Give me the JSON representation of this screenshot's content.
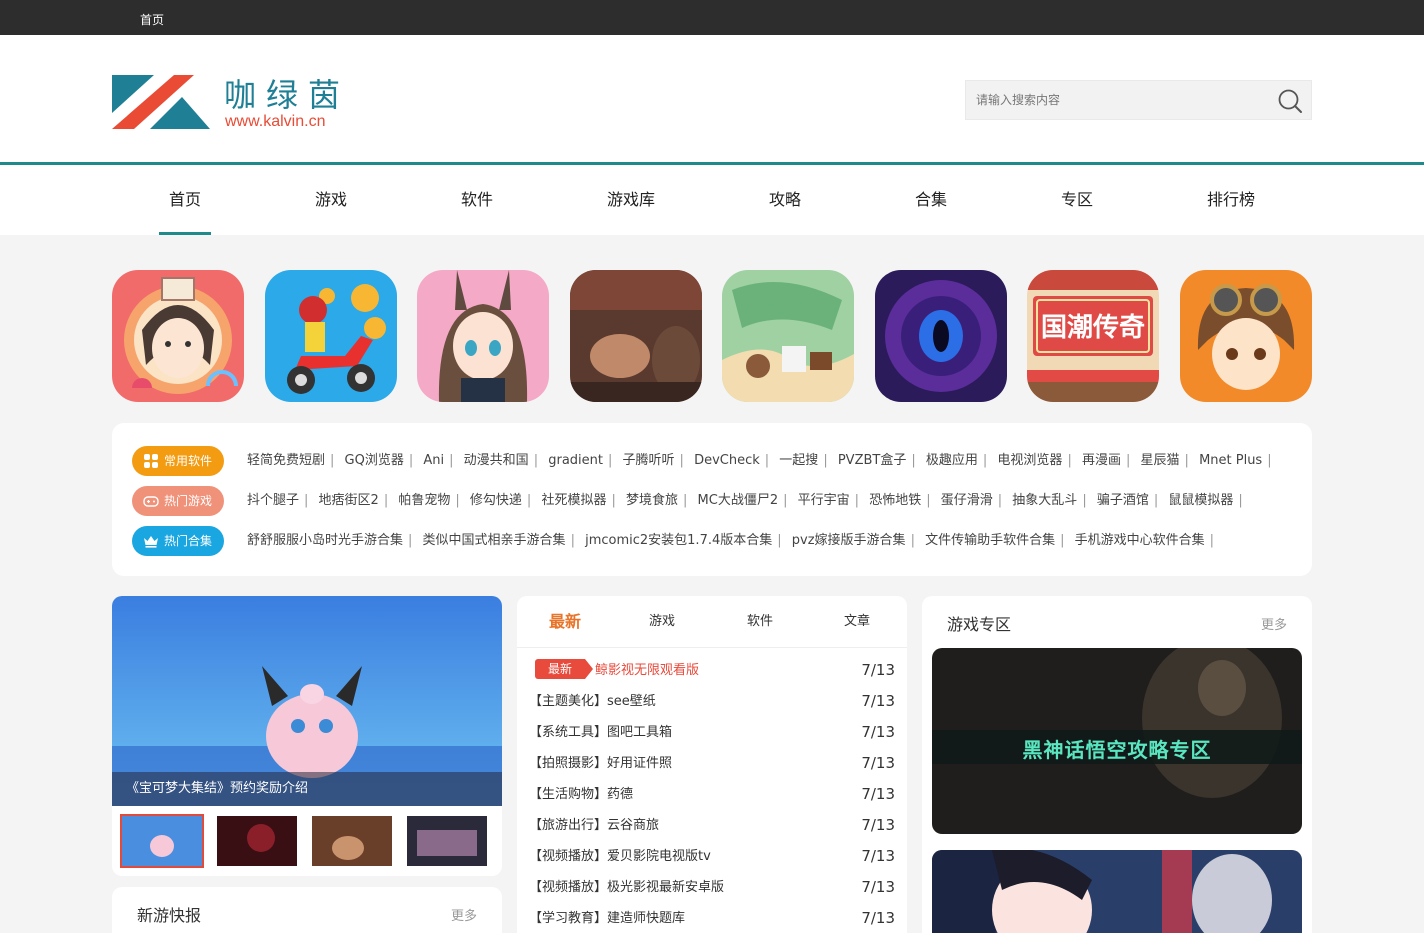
{
  "topbar": {
    "home_link": "首页"
  },
  "brand": {
    "name_cn": "咖绿茵",
    "domain": "www.kalvin.cn",
    "colors": {
      "teal": "#1e7f95",
      "red": "#e94b35"
    }
  },
  "search": {
    "placeholder": "请输入搜索内容",
    "icon": "search-icon"
  },
  "nav": {
    "items": [
      {
        "label": "首页",
        "active": true
      },
      {
        "label": "游戏"
      },
      {
        "label": "软件"
      },
      {
        "label": "游戏库"
      },
      {
        "label": "攻略"
      },
      {
        "label": "合集"
      },
      {
        "label": "专区"
      },
      {
        "label": "排行榜"
      }
    ]
  },
  "featured_apps": [
    {
      "icon": "app-icon-ancient-girl"
    },
    {
      "icon": "app-icon-scooter-rider"
    },
    {
      "icon": "app-icon-anime-bunny-girl"
    },
    {
      "icon": "app-icon-dog-scene"
    },
    {
      "icon": "app-icon-map-journey"
    },
    {
      "icon": "app-icon-purple-eye"
    },
    {
      "icon": "app-icon-guochao-legend",
      "text": "国潮传奇"
    },
    {
      "icon": "app-icon-goggles-boy"
    }
  ],
  "tag_rows": [
    {
      "badge": "常用软件",
      "badge_icon": "grid-icon",
      "color": "#f39c12",
      "items": [
        "轻简免费短剧",
        "GQ浏览器",
        "Ani",
        "动漫共和国",
        "gradient",
        "子腾听听",
        "DevCheck",
        "一起搜",
        "PVZBT盒子",
        "极趣应用",
        "电视浏览器",
        "再漫画",
        "星辰猫",
        "Mnet Plus"
      ]
    },
    {
      "badge": "热门游戏",
      "badge_icon": "gamepad-icon",
      "color": "#f0927a",
      "items": [
        "抖个腿子",
        "地痞街区2",
        "帕鲁宠物",
        "修勾快递",
        "社死模拟器",
        "梦境食旅",
        "MC大战僵尸2",
        "平行宇宙",
        "恐怖地铁",
        "蛋仔滑滑",
        "抽象大乱斗",
        "骗子酒馆",
        "鼠鼠模拟器"
      ]
    },
    {
      "badge": "热门合集",
      "badge_icon": "crown-icon",
      "color": "#1aa6e0",
      "items": [
        "舒舒服服小岛时光手游合集",
        "类似中国式相亲手游合集",
        "jmcomic2安装包1.7.4版本合集",
        "pvz嫁接版手游合集",
        "文件传输助手软件合集",
        "手机游戏中心软件合集"
      ]
    }
  ],
  "slider": {
    "caption": "《宝可梦大集结》预约奖励介绍",
    "thumbs": [
      "thumb-pokemon",
      "thumb-red-dark",
      "thumb-dog",
      "thumb-battle"
    ]
  },
  "new_games": {
    "title": "新游快报",
    "more": "更多"
  },
  "news": {
    "tabs": [
      "最新",
      "游戏",
      "软件",
      "文章"
    ],
    "hot_badge": "最新",
    "rows": [
      {
        "cat": "",
        "title": "鲸影视无限观看版",
        "date": "7/13",
        "hot": true
      },
      {
        "cat": "【主题美化】",
        "title": "see壁纸",
        "date": "7/13"
      },
      {
        "cat": "【系统工具】",
        "title": "图吧工具箱",
        "date": "7/13"
      },
      {
        "cat": "【拍照摄影】",
        "title": "好用证件照",
        "date": "7/13"
      },
      {
        "cat": "【生活购物】",
        "title": "药德",
        "date": "7/13"
      },
      {
        "cat": "【旅游出行】",
        "title": "云谷商旅",
        "date": "7/13"
      },
      {
        "cat": "【视频播放】",
        "title": "爱贝影院电视版tv",
        "date": "7/13"
      },
      {
        "cat": "【视频播放】",
        "title": "极光影视最新安卓版",
        "date": "7/13"
      },
      {
        "cat": "【学习教育】",
        "title": "建造师快题库",
        "date": "7/13"
      }
    ]
  },
  "zone": {
    "title": "游戏专区",
    "more": "更多",
    "cards": [
      {
        "label": "黑神话悟空攻略专区"
      },
      {
        "label": ""
      }
    ]
  }
}
